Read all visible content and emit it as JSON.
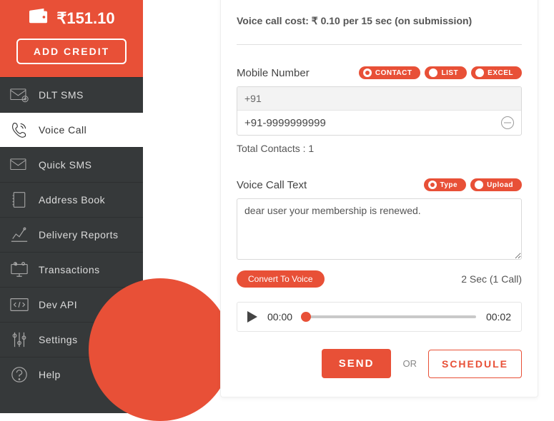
{
  "wallet": {
    "balance": "₹151.10",
    "add_credit": "ADD CREDIT"
  },
  "nav": {
    "dlt_sms": "DLT SMS",
    "voice_call": "Voice Call",
    "quick_sms": "Quick SMS",
    "address_book": "Address Book",
    "delivery_reports": "Delivery Reports",
    "transactions": "Transactions",
    "dev_api": "Dev API",
    "settings": "Settings",
    "help": "Help"
  },
  "cost_line": "Voice call cost: ₹ 0.10 per 15 sec (on submission)",
  "mobile": {
    "label": "Mobile Number",
    "pill_contact": "CONTACT",
    "pill_list": "LIST",
    "pill_excel": "EXCEL",
    "prefix": "+91",
    "number": "+91-9999999999",
    "total": "Total Contacts : 1"
  },
  "voice": {
    "label": "Voice Call Text",
    "pill_type": "Type",
    "pill_upload": "Upload",
    "text": "dear user your membership is renewed.",
    "convert": "Convert To Voice",
    "duration": "2 Sec (1 Call)"
  },
  "player": {
    "current": "00:00",
    "total": "00:02"
  },
  "actions": {
    "send": "SEND",
    "or": "OR",
    "schedule": "SCHEDULE"
  }
}
